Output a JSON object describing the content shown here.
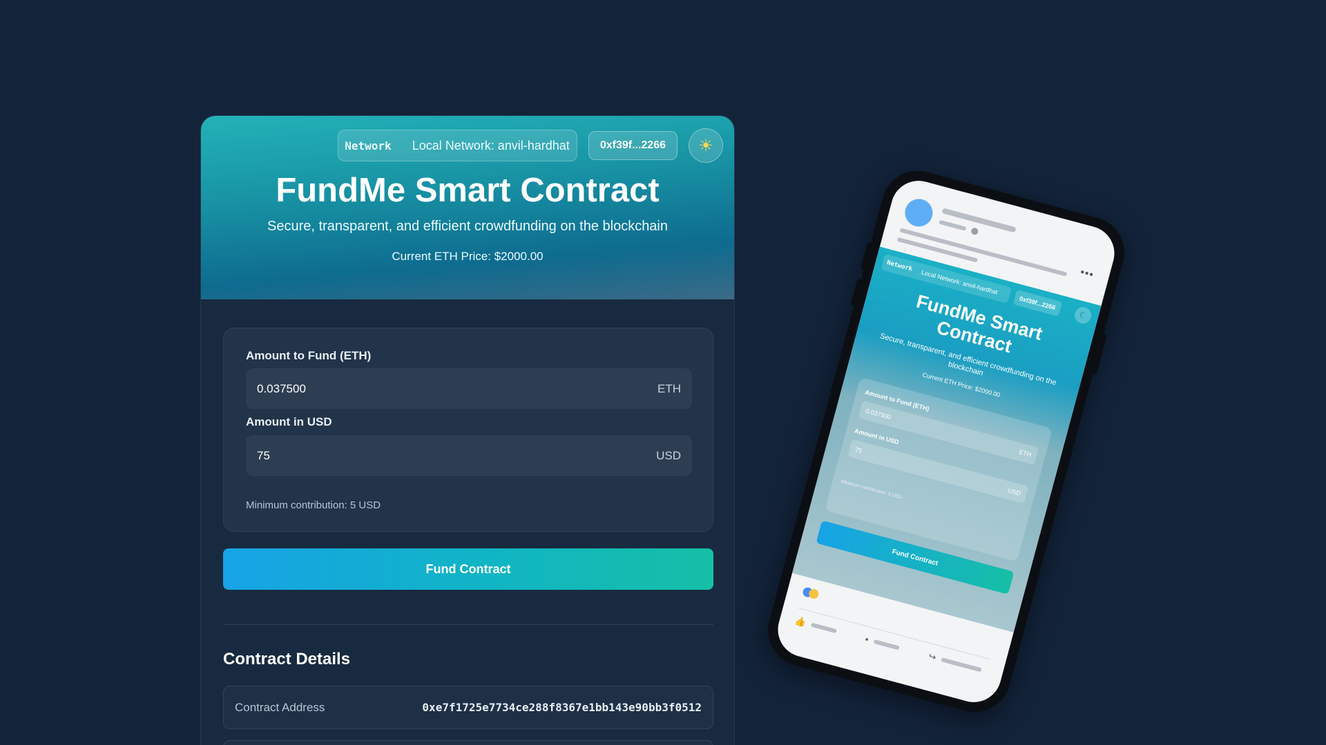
{
  "header": {
    "network_tag": "Network",
    "network_name": "Local Network: anvil-hardhat",
    "account": "0xf39f...2266",
    "theme_icon": "sun-icon",
    "title": "FundMe Smart Contract",
    "subtitle": "Secure, transparent, and efficient crowdfunding on the blockchain",
    "eth_price": "Current ETH Price: $2000.00"
  },
  "form": {
    "eth_label": "Amount to Fund (ETH)",
    "eth_value": "0.037500",
    "eth_unit": "ETH",
    "usd_label": "Amount in USD",
    "usd_value": "75",
    "usd_unit": "USD",
    "min_note": "Minimum contribution: 5 USD",
    "fund_button": "Fund Contract"
  },
  "details": {
    "title": "Contract Details",
    "rows": [
      {
        "key": "Contract Address",
        "value": "0xe7f1725e7734ce288f8367e1bb143e90bb3f0512"
      }
    ]
  },
  "phone": {
    "network_tag": "Network",
    "network_name": "Local Network: anvil-hardhat",
    "account": "0xf39f...2266",
    "theme_icon": "moon-icon",
    "title": "FundMe Smart Contract",
    "subtitle": "Secure, transparent, and efficient crowdfunding on the blockchain",
    "eth_price": "Current ETH Price: $2000.00",
    "eth_label": "Amount to Fund (ETH)",
    "eth_value": "0.037500",
    "eth_unit": "ETH",
    "usd_label": "Amount in USD",
    "usd_value": "75",
    "usd_unit": "USD",
    "min_note": "Minimum contribution: 5 USD",
    "fund_button": "Fund Contract"
  },
  "colors": {
    "background": "#13233a",
    "card": "#182a3f",
    "accent_start": "#17a3e6",
    "accent_end": "#16bfa6"
  }
}
